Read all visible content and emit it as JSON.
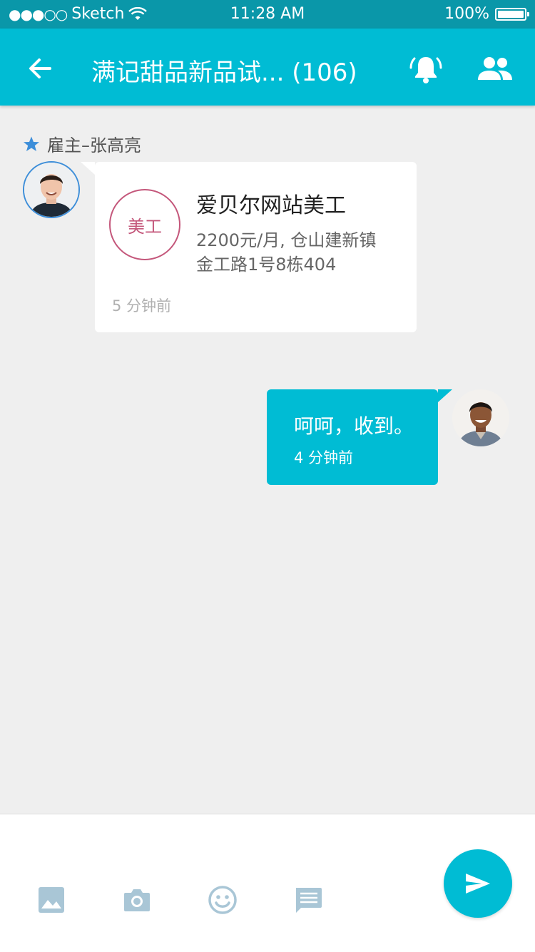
{
  "status_bar": {
    "carrier": "Sketch",
    "time": "11:28 AM",
    "battery": "100%"
  },
  "header": {
    "title": "满记甜品新品试... (106)",
    "icons": [
      "back-arrow-icon",
      "bell-ring-icon",
      "group-icon"
    ]
  },
  "chat": {
    "incoming": {
      "sender_label": "雇主–张高亮",
      "card": {
        "badge": "美工",
        "title": "爱贝尔网站美工",
        "line1": "2200元/月, 仓山建新镇",
        "line2": "金工路1号8栋404",
        "time": "5 分钟前"
      }
    },
    "outgoing": {
      "message": "呵呵，收到。",
      "time": "4 分钟前"
    }
  },
  "toolbar": {
    "icons": [
      "image-icon",
      "camera-icon",
      "emoji-icon",
      "message-icon",
      "send-icon"
    ]
  },
  "colors": {
    "accent": "#00bcd4",
    "status_bar": "#0a97a9",
    "badge": "#c4577b",
    "star": "#3d8ed9",
    "tool_icon": "#a9c6d6"
  }
}
